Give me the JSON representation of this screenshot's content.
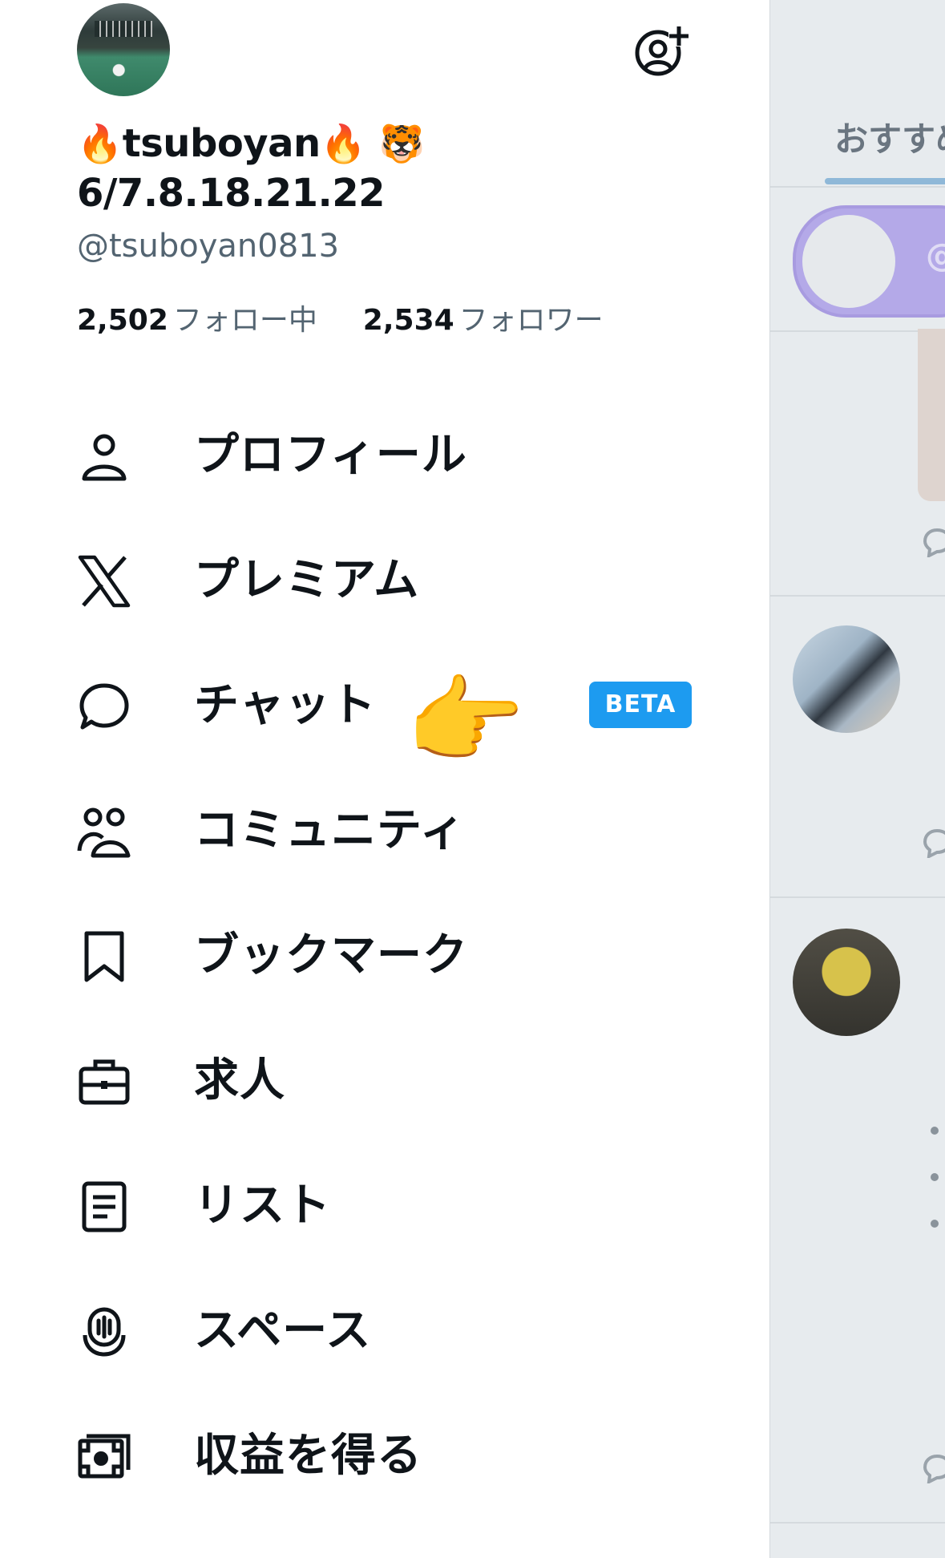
{
  "profile": {
    "name_line1": "tsuboyan",
    "name_line2": "6/7.8.18.21.22",
    "handle": "@tsuboyan0813",
    "following_count": "2,502",
    "following_label": "フォロー中",
    "followers_count": "2,534",
    "followers_label": "フォロワー"
  },
  "menu": [
    {
      "label": "プロフィール",
      "icon": "person-icon"
    },
    {
      "label": "プレミアム",
      "icon": "x-logo-icon"
    },
    {
      "label": "チャット",
      "icon": "chat-bubble-icon",
      "badge": "BETA"
    },
    {
      "label": "コミュニティ",
      "icon": "communities-icon"
    },
    {
      "label": "ブックマーク",
      "icon": "bookmark-icon"
    },
    {
      "label": "求人",
      "icon": "briefcase-icon"
    },
    {
      "label": "リスト",
      "icon": "list-icon"
    },
    {
      "label": "スペース",
      "icon": "spaces-icon"
    },
    {
      "label": "収益を得る",
      "icon": "money-icon"
    }
  ],
  "timeline": {
    "tab_label": "おすすめ",
    "pill_text": "@"
  },
  "colors": {
    "accent": "#1d9bf0",
    "text": "#0f1419",
    "secondary": "#536471"
  }
}
